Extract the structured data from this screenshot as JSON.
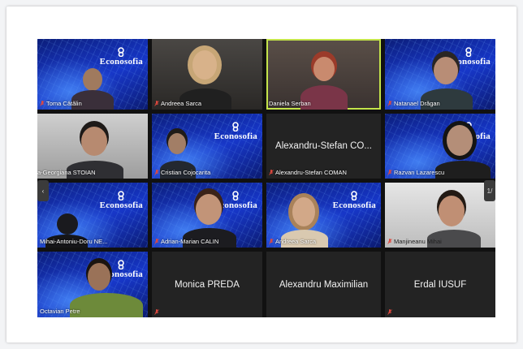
{
  "brand": {
    "logo_text": "Econosofia",
    "logo_icon": "econosofia-icon"
  },
  "colors": {
    "active_speaker": "#c4e44a",
    "mic_muted": "#e0483e"
  },
  "participants": [
    {
      "name": "Toma Cătălin",
      "muted": true
    },
    {
      "name": "Andreea Sarca",
      "muted": true
    },
    {
      "name": "Daniela Serban",
      "muted": false
    },
    {
      "name": "Natanael Drăgan",
      "muted": true
    },
    {
      "name": "a-Georgiana STOIAN",
      "muted": false
    },
    {
      "name": "Cristian Cojocarita",
      "muted": true
    },
    {
      "name": "Alexandru-Stefan COMAN",
      "muted": true,
      "display_name": "Alexandru-Stefan CO..."
    },
    {
      "name": "Razvan Lazarescu",
      "muted": true
    },
    {
      "name": "Mihai-Antoniu-Doru NE...",
      "muted": false
    },
    {
      "name": "Adrian-Marian CALIN",
      "muted": true
    },
    {
      "name": "Andreea Sarca",
      "muted": true
    },
    {
      "name": "Manjineanu Mihai",
      "muted": true
    },
    {
      "name": "Octavian Petre",
      "muted": false
    },
    {
      "name": "",
      "muted": true,
      "display_name": "Monica PREDA"
    },
    {
      "name": "",
      "muted": false,
      "display_name": "Alexandru Maximilian"
    },
    {
      "name": "",
      "muted": true,
      "display_name": "Erdal IUSUF"
    }
  ],
  "nav": {
    "prev_label": "‹",
    "next_label": "1/"
  }
}
